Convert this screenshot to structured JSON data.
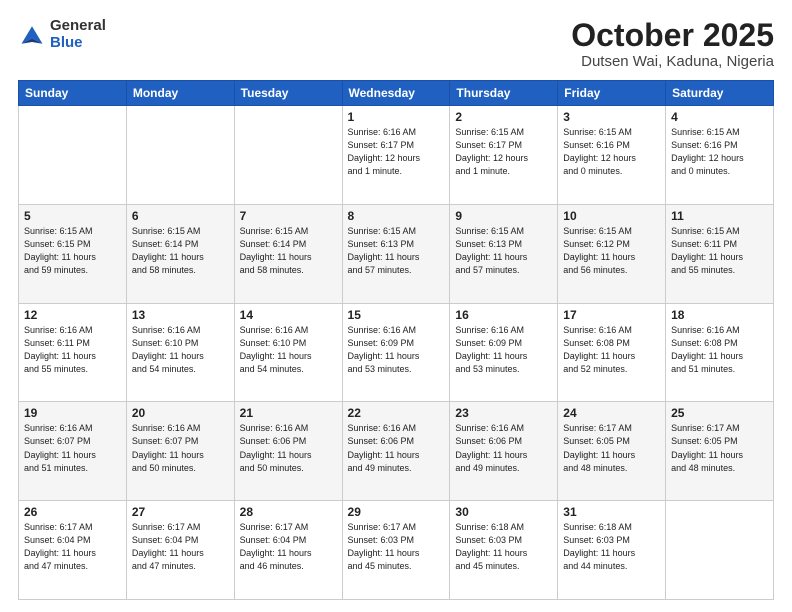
{
  "header": {
    "logo_general": "General",
    "logo_blue": "Blue",
    "month_title": "October 2025",
    "location": "Dutsen Wai, Kaduna, Nigeria"
  },
  "weekdays": [
    "Sunday",
    "Monday",
    "Tuesday",
    "Wednesday",
    "Thursday",
    "Friday",
    "Saturday"
  ],
  "weeks": [
    [
      {
        "day": "",
        "info": ""
      },
      {
        "day": "",
        "info": ""
      },
      {
        "day": "",
        "info": ""
      },
      {
        "day": "1",
        "info": "Sunrise: 6:16 AM\nSunset: 6:17 PM\nDaylight: 12 hours\nand 1 minute."
      },
      {
        "day": "2",
        "info": "Sunrise: 6:15 AM\nSunset: 6:17 PM\nDaylight: 12 hours\nand 1 minute."
      },
      {
        "day": "3",
        "info": "Sunrise: 6:15 AM\nSunset: 6:16 PM\nDaylight: 12 hours\nand 0 minutes."
      },
      {
        "day": "4",
        "info": "Sunrise: 6:15 AM\nSunset: 6:16 PM\nDaylight: 12 hours\nand 0 minutes."
      }
    ],
    [
      {
        "day": "5",
        "info": "Sunrise: 6:15 AM\nSunset: 6:15 PM\nDaylight: 11 hours\nand 59 minutes."
      },
      {
        "day": "6",
        "info": "Sunrise: 6:15 AM\nSunset: 6:14 PM\nDaylight: 11 hours\nand 58 minutes."
      },
      {
        "day": "7",
        "info": "Sunrise: 6:15 AM\nSunset: 6:14 PM\nDaylight: 11 hours\nand 58 minutes."
      },
      {
        "day": "8",
        "info": "Sunrise: 6:15 AM\nSunset: 6:13 PM\nDaylight: 11 hours\nand 57 minutes."
      },
      {
        "day": "9",
        "info": "Sunrise: 6:15 AM\nSunset: 6:13 PM\nDaylight: 11 hours\nand 57 minutes."
      },
      {
        "day": "10",
        "info": "Sunrise: 6:15 AM\nSunset: 6:12 PM\nDaylight: 11 hours\nand 56 minutes."
      },
      {
        "day": "11",
        "info": "Sunrise: 6:15 AM\nSunset: 6:11 PM\nDaylight: 11 hours\nand 55 minutes."
      }
    ],
    [
      {
        "day": "12",
        "info": "Sunrise: 6:16 AM\nSunset: 6:11 PM\nDaylight: 11 hours\nand 55 minutes."
      },
      {
        "day": "13",
        "info": "Sunrise: 6:16 AM\nSunset: 6:10 PM\nDaylight: 11 hours\nand 54 minutes."
      },
      {
        "day": "14",
        "info": "Sunrise: 6:16 AM\nSunset: 6:10 PM\nDaylight: 11 hours\nand 54 minutes."
      },
      {
        "day": "15",
        "info": "Sunrise: 6:16 AM\nSunset: 6:09 PM\nDaylight: 11 hours\nand 53 minutes."
      },
      {
        "day": "16",
        "info": "Sunrise: 6:16 AM\nSunset: 6:09 PM\nDaylight: 11 hours\nand 53 minutes."
      },
      {
        "day": "17",
        "info": "Sunrise: 6:16 AM\nSunset: 6:08 PM\nDaylight: 11 hours\nand 52 minutes."
      },
      {
        "day": "18",
        "info": "Sunrise: 6:16 AM\nSunset: 6:08 PM\nDaylight: 11 hours\nand 51 minutes."
      }
    ],
    [
      {
        "day": "19",
        "info": "Sunrise: 6:16 AM\nSunset: 6:07 PM\nDaylight: 11 hours\nand 51 minutes."
      },
      {
        "day": "20",
        "info": "Sunrise: 6:16 AM\nSunset: 6:07 PM\nDaylight: 11 hours\nand 50 minutes."
      },
      {
        "day": "21",
        "info": "Sunrise: 6:16 AM\nSunset: 6:06 PM\nDaylight: 11 hours\nand 50 minutes."
      },
      {
        "day": "22",
        "info": "Sunrise: 6:16 AM\nSunset: 6:06 PM\nDaylight: 11 hours\nand 49 minutes."
      },
      {
        "day": "23",
        "info": "Sunrise: 6:16 AM\nSunset: 6:06 PM\nDaylight: 11 hours\nand 49 minutes."
      },
      {
        "day": "24",
        "info": "Sunrise: 6:17 AM\nSunset: 6:05 PM\nDaylight: 11 hours\nand 48 minutes."
      },
      {
        "day": "25",
        "info": "Sunrise: 6:17 AM\nSunset: 6:05 PM\nDaylight: 11 hours\nand 48 minutes."
      }
    ],
    [
      {
        "day": "26",
        "info": "Sunrise: 6:17 AM\nSunset: 6:04 PM\nDaylight: 11 hours\nand 47 minutes."
      },
      {
        "day": "27",
        "info": "Sunrise: 6:17 AM\nSunset: 6:04 PM\nDaylight: 11 hours\nand 47 minutes."
      },
      {
        "day": "28",
        "info": "Sunrise: 6:17 AM\nSunset: 6:04 PM\nDaylight: 11 hours\nand 46 minutes."
      },
      {
        "day": "29",
        "info": "Sunrise: 6:17 AM\nSunset: 6:03 PM\nDaylight: 11 hours\nand 45 minutes."
      },
      {
        "day": "30",
        "info": "Sunrise: 6:18 AM\nSunset: 6:03 PM\nDaylight: 11 hours\nand 45 minutes."
      },
      {
        "day": "31",
        "info": "Sunrise: 6:18 AM\nSunset: 6:03 PM\nDaylight: 11 hours\nand 44 minutes."
      },
      {
        "day": "",
        "info": ""
      }
    ]
  ]
}
